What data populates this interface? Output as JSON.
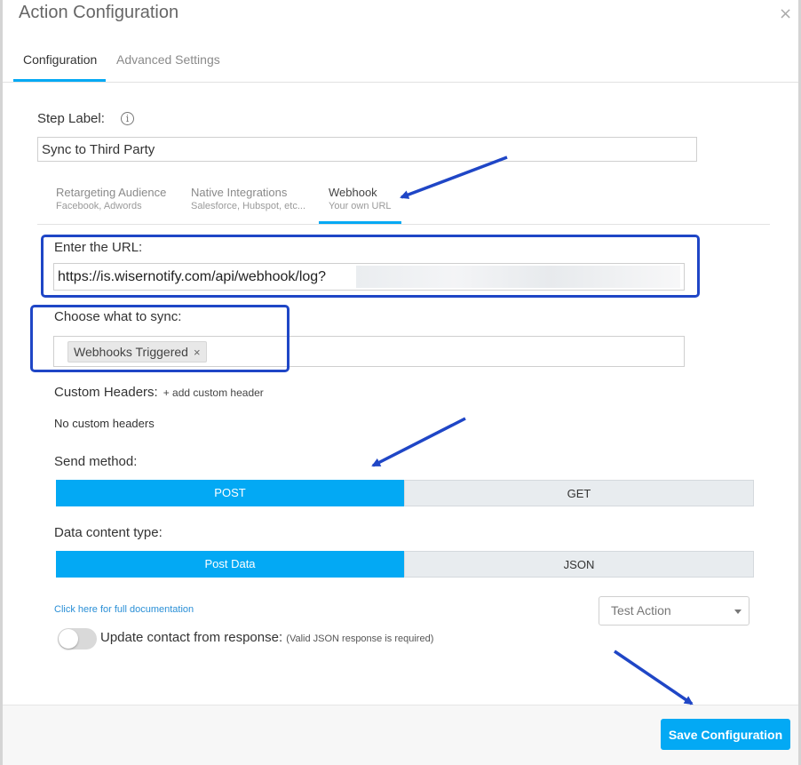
{
  "dialog": {
    "title": "Action Configuration",
    "close_symbol": "×"
  },
  "main_tabs": [
    {
      "label": "Configuration",
      "active": true
    },
    {
      "label": "Advanced Settings",
      "active": false
    }
  ],
  "step_label": {
    "label": "Step Label:",
    "value": "Sync to Third Party"
  },
  "sub_tabs": [
    {
      "title": "Retargeting Audience",
      "subtitle": "Facebook, Adwords",
      "active": false
    },
    {
      "title": "Native Integrations",
      "subtitle": "Salesforce, Hubspot, etc...",
      "active": false
    },
    {
      "title": "Webhook",
      "subtitle": "Your own URL",
      "active": true
    }
  ],
  "url": {
    "label": "Enter the URL:",
    "value": "https://is.wisernotify.com/api/webhook/log?"
  },
  "sync": {
    "label": "Choose what to sync:",
    "tags": [
      "Webhooks Triggered"
    ],
    "remove_symbol": "×"
  },
  "custom_headers": {
    "label": "Custom Headers:",
    "add_label": "+ add custom header",
    "empty_text": "No custom headers"
  },
  "send_method": {
    "label": "Send method:",
    "options": [
      "POST",
      "GET"
    ],
    "selected": "POST"
  },
  "content_type": {
    "label": "Data content type:",
    "options": [
      "Post Data",
      "JSON"
    ],
    "selected": "Post Data"
  },
  "documentation_link": "Click here for full documentation",
  "test_action": {
    "selected": "Test Action"
  },
  "update_contact": {
    "label": "Update contact from response:",
    "note": "(Valid JSON response is required)",
    "enabled": false
  },
  "footer": {
    "save_label": "Save Configuration"
  },
  "colors": {
    "accent": "#03a9f4",
    "annotation": "#1f46c6"
  }
}
